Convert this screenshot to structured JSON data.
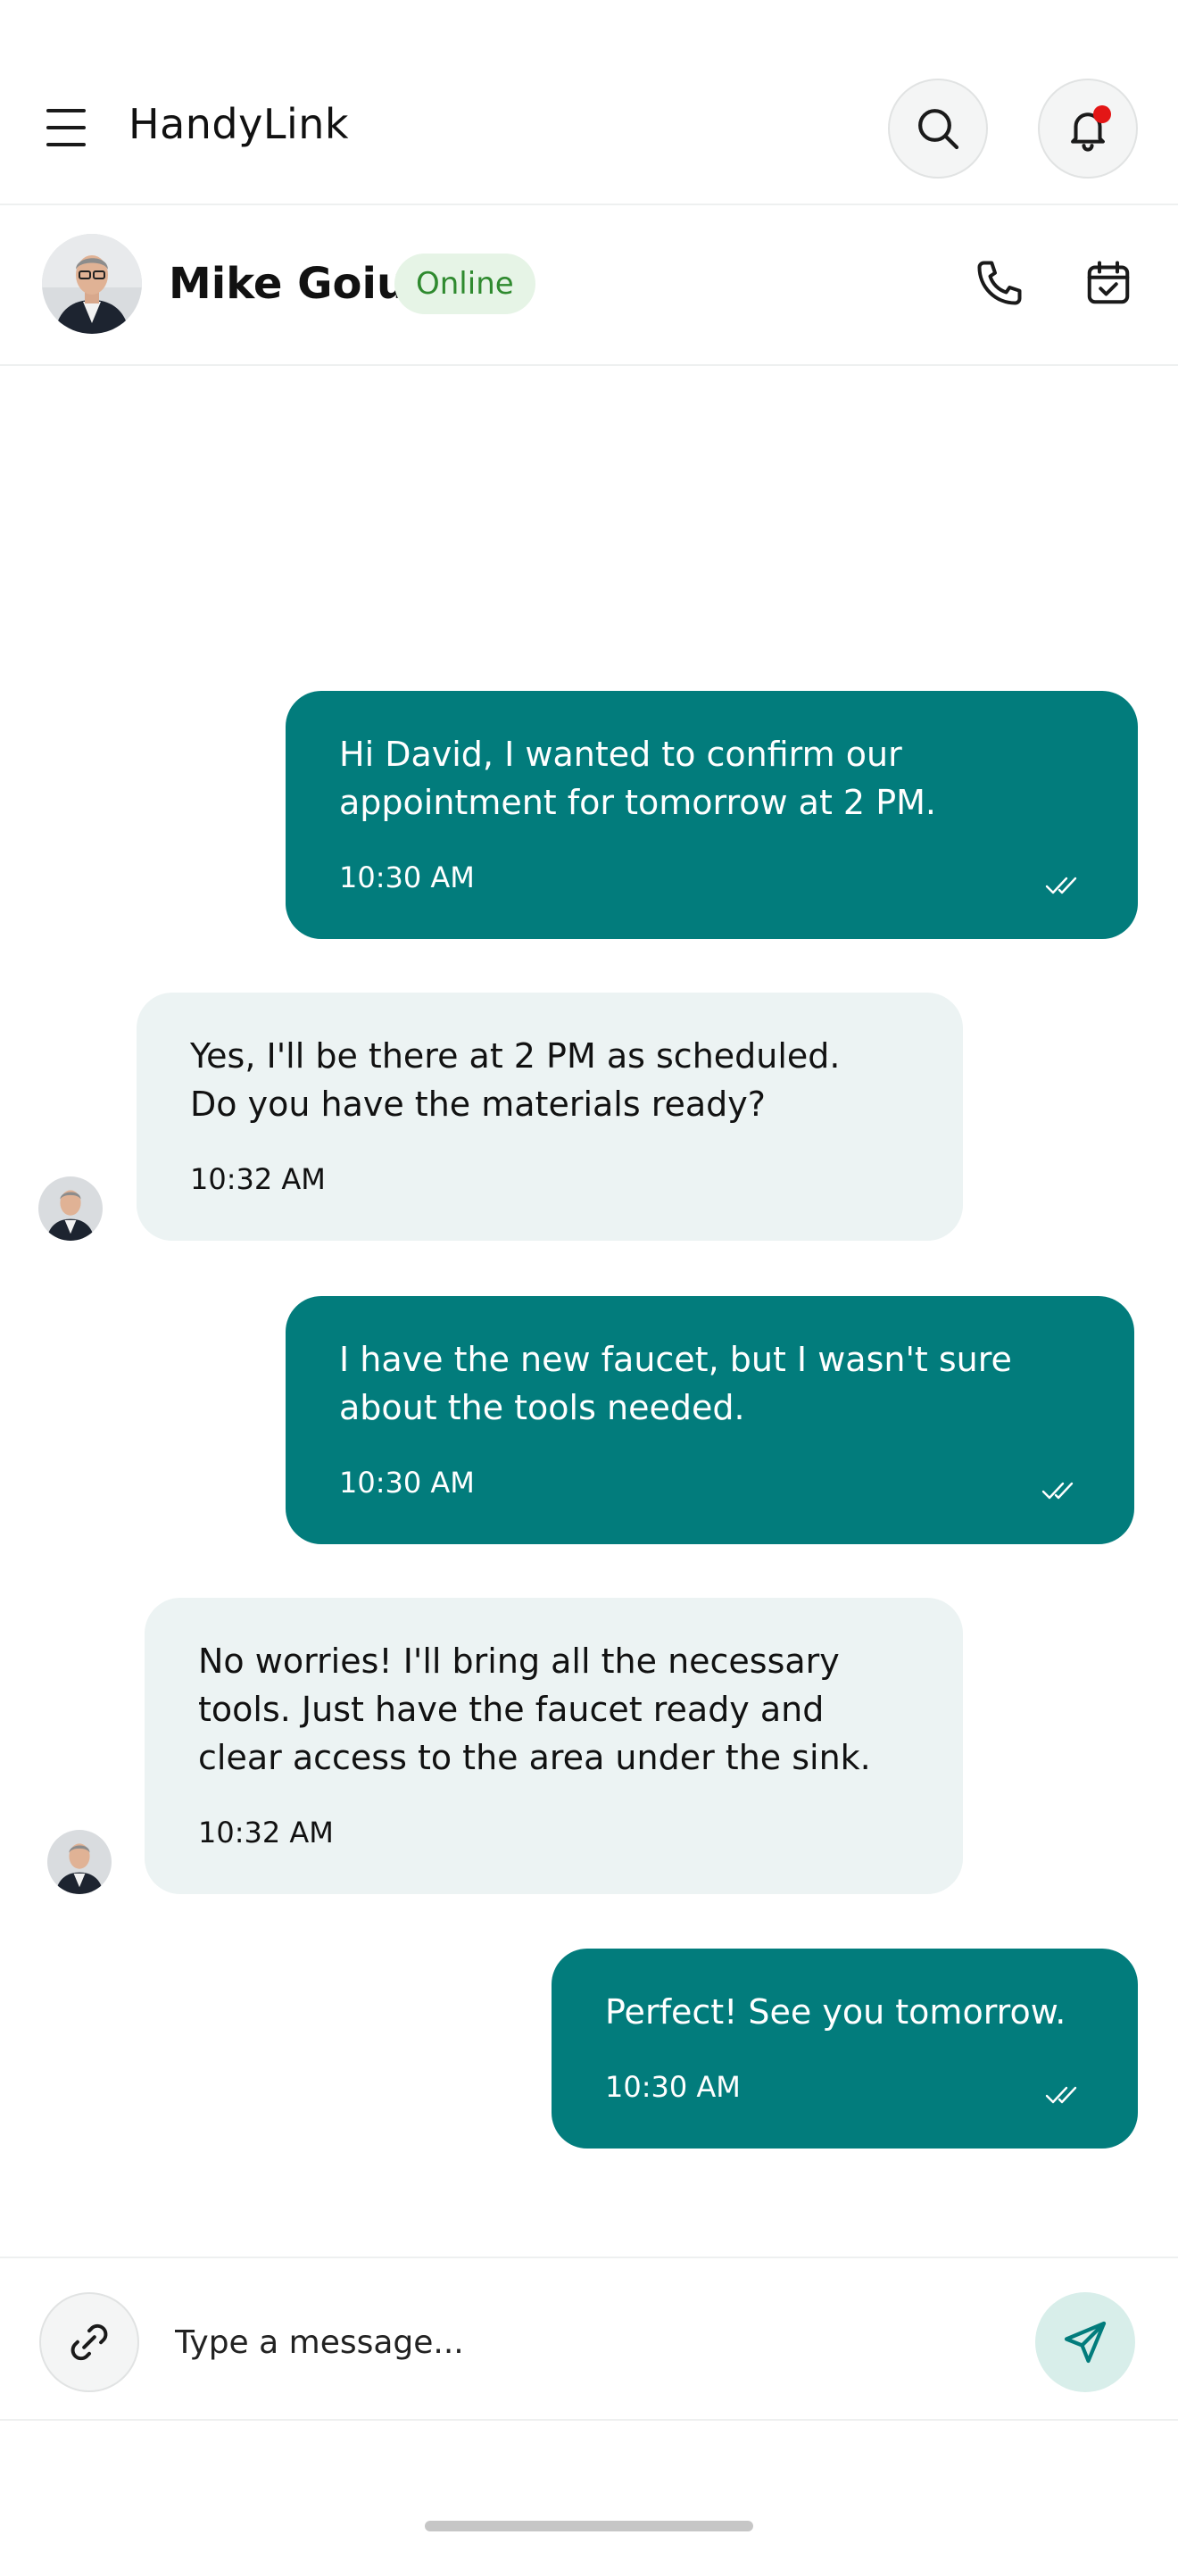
{
  "app": {
    "title": "HandyLink"
  },
  "chat_header": {
    "contact_name": "Mike Goiut",
    "status": "Online"
  },
  "messages": [
    {
      "direction": "out",
      "text": "Hi David, I wanted to confirm our\nappointment for tomorrow at 2 PM.",
      "time": "10:30 AM"
    },
    {
      "direction": "in",
      "text": "Yes, I'll be there at 2 PM as scheduled.\nDo you have the materials ready?",
      "time": "10:32 AM"
    },
    {
      "direction": "out",
      "text": "I have the new faucet, but I wasn't sure\nabout the tools needed.",
      "time": "10:30 AM"
    },
    {
      "direction": "in",
      "text": "No worries! I'll bring all the necessary\ntools. Just have the faucet ready and\nclear access to the area under the sink.",
      "time": "10:32 AM"
    },
    {
      "direction": "out",
      "text": "Perfect! See you tomorrow.",
      "time": "10:30 AM"
    }
  ],
  "composer": {
    "placeholder": "Type a message..."
  },
  "colors": {
    "outgoing_bubble": "#027c7c",
    "incoming_bubble": "#ecf3f3",
    "online_badge_bg": "#e6f4e6",
    "online_badge_text": "#2f8a2f",
    "notification_dot": "#e31616",
    "send_button_bg": "#d8eeea"
  },
  "icons": {
    "menu": "hamburger-icon",
    "search": "search-icon",
    "notifications": "bell-icon",
    "call": "phone-icon",
    "schedule": "calendar-check-icon",
    "read_receipt": "double-check-icon",
    "attach": "paperclip-icon",
    "send": "send-icon"
  }
}
